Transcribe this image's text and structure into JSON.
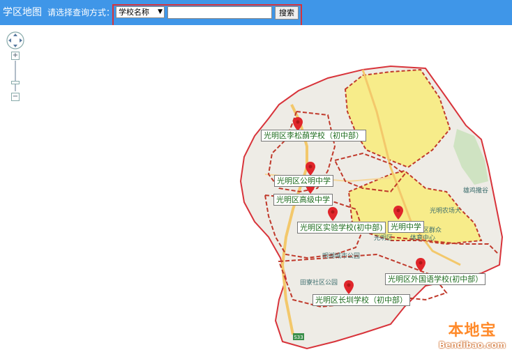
{
  "header": {
    "title": "学区地图",
    "query_label": "请选择查询方式：",
    "query_mode": "学校名称",
    "search_value": "",
    "search_button": "搜索"
  },
  "map_controls": {
    "zoom_in": "+",
    "zoom_out": "−"
  },
  "schools": [
    {
      "name": "光明区李松蓢学校（初中部）"
    },
    {
      "name": "光明区公明中学"
    },
    {
      "name": "光明区高级中学"
    },
    {
      "name": "光明区实验学校(初中部)"
    },
    {
      "name": "光明中学"
    },
    {
      "name": "光明区外国语学校(初中部）"
    },
    {
      "name": "光明区长圳学校（初中部）"
    }
  ],
  "pois": [
    {
      "name": "雄鸡撒谷"
    },
    {
      "name": "光明农场大"
    },
    {
      "name": "光明区群众体育中心"
    },
    {
      "name": "明湖城市公园"
    },
    {
      "name": "田寮社区公园"
    },
    {
      "name": "光明区"
    }
  ],
  "road_signs": [
    "S33"
  ],
  "watermark": {
    "text_cn": "本地宝",
    "text_en": "Bendibao.com"
  },
  "colors": {
    "header_bg": "#3f96e8",
    "boundary": "#d8333a",
    "zone_fill": "#f7ec8a",
    "road": "#f3c86b",
    "label_text": "#1f6d1f",
    "watermark": "#ff8a2a"
  }
}
